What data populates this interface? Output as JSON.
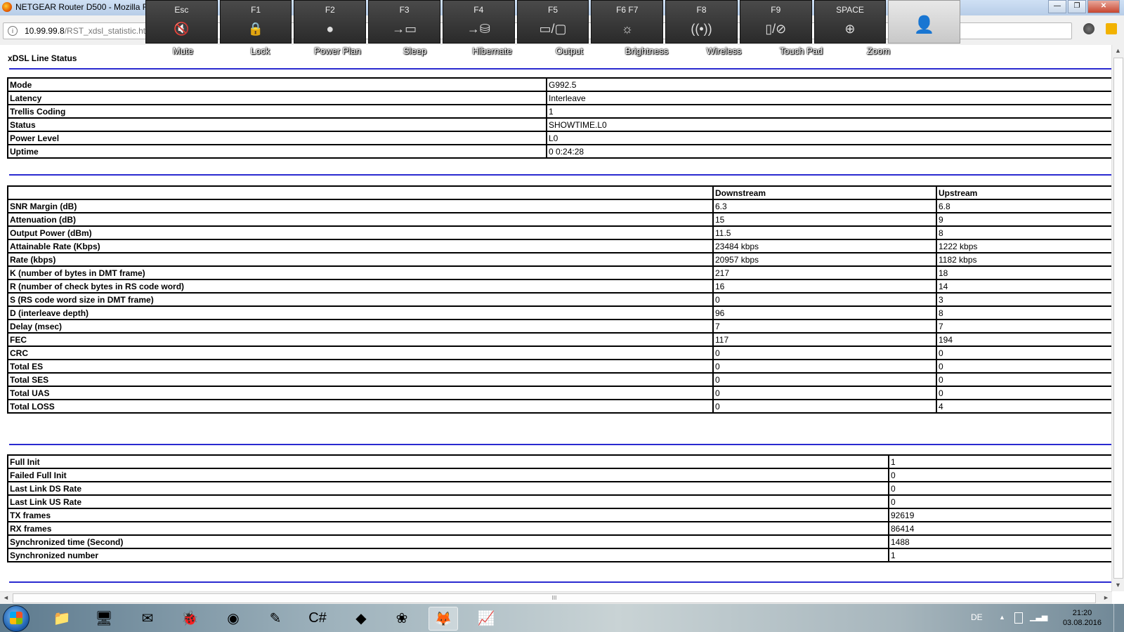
{
  "window": {
    "title": "NETGEAR Router D500 - Mozilla Firefox",
    "minimize": "—",
    "maximize": "❐",
    "close": "✕"
  },
  "browser": {
    "url_host": "10.99.99.8",
    "url_path": "/RST_xdsl_statistic.htm",
    "info_icon": "i"
  },
  "hotkeys": [
    {
      "key": "Esc",
      "label": "Mute",
      "icon": "mute-icon",
      "glyph": "🔇"
    },
    {
      "key": "F1",
      "label": "Lock",
      "icon": "lock-icon",
      "glyph": "🔒"
    },
    {
      "key": "F2",
      "label": "Power Plan",
      "icon": "power-plan-icon",
      "glyph": "●"
    },
    {
      "key": "F3",
      "label": "Sleep",
      "icon": "sleep-icon",
      "glyph": "→▭"
    },
    {
      "key": "F4",
      "label": "Hibernate",
      "icon": "hibernate-icon",
      "glyph": "→⛁"
    },
    {
      "key": "F5",
      "label": "Output",
      "icon": "output-icon",
      "glyph": "▭/▢"
    },
    {
      "key": "F6      F7",
      "label": "Brightness",
      "icon": "brightness-icon",
      "glyph": "☼"
    },
    {
      "key": "F8",
      "label": "Wireless",
      "icon": "wireless-icon",
      "glyph": "((•))"
    },
    {
      "key": "F9",
      "label": "Touch Pad",
      "icon": "touchpad-icon",
      "glyph": "▯/⊘"
    },
    {
      "key": "SPACE",
      "label": "Zoom",
      "icon": "zoom-icon",
      "glyph": "⊕"
    }
  ],
  "page": {
    "title": "xDSL Line Status"
  },
  "line_status": [
    {
      "label": "Mode",
      "value": "G992.5"
    },
    {
      "label": "Latency",
      "value": "Interleave"
    },
    {
      "label": "Trellis Coding",
      "value": "1"
    },
    {
      "label": "Status",
      "value": "SHOWTIME.L0"
    },
    {
      "label": "Power Level",
      "value": "L0"
    },
    {
      "label": "Uptime",
      "value": "0 0:24:28"
    }
  ],
  "stats": {
    "headers": [
      "",
      "Downstream",
      "Upstream"
    ],
    "rows": [
      {
        "label": "SNR Margin (dB)",
        "down": "6.3",
        "up": "6.8"
      },
      {
        "label": "Attenuation (dB)",
        "down": "15",
        "up": "9"
      },
      {
        "label": "Output Power (dBm)",
        "down": "11.5",
        "up": "8"
      },
      {
        "label": "Attainable Rate (Kbps)",
        "down": "23484 kbps",
        "up": "1222 kbps"
      },
      {
        "label": "Rate (kbps)",
        "down": "20957 kbps",
        "up": "1182 kbps"
      },
      {
        "label": "K (number of bytes in DMT frame)",
        "down": "217",
        "up": "18"
      },
      {
        "label": "R (number of check bytes in RS code word)",
        "down": "16",
        "up": "14"
      },
      {
        "label": "S (RS code word size in DMT frame)",
        "down": "0",
        "up": "3"
      },
      {
        "label": "D (interleave depth)",
        "down": "96",
        "up": "8"
      },
      {
        "label": "Delay (msec)",
        "down": "7",
        "up": "7"
      },
      {
        "label": "FEC",
        "down": "117",
        "up": "194"
      },
      {
        "label": "CRC",
        "down": "0",
        "up": "0"
      },
      {
        "label": "Total ES",
        "down": "0",
        "up": "0"
      },
      {
        "label": "Total SES",
        "down": "0",
        "up": "0"
      },
      {
        "label": "Total UAS",
        "down": "0",
        "up": "0"
      },
      {
        "label": "Total LOSS",
        "down": "0",
        "up": "4"
      }
    ]
  },
  "counters": [
    {
      "label": "Full Init",
      "value": "1"
    },
    {
      "label": "Failed Full Init",
      "value": "0"
    },
    {
      "label": "Last Link DS Rate",
      "value": "0"
    },
    {
      "label": "Last Link US Rate",
      "value": "0"
    },
    {
      "label": "TX frames",
      "value": "92619"
    },
    {
      "label": "RX frames",
      "value": "86414"
    },
    {
      "label": "Synchronized time (Second)",
      "value": "1488"
    },
    {
      "label": "Synchronized number",
      "value": "1"
    }
  ],
  "scroll": {
    "grip": "III",
    "up": "▲",
    "down": "▼",
    "left": "◄",
    "right": "►"
  },
  "taskbar": {
    "apps": [
      {
        "name": "explorer-icon",
        "glyph": "📁"
      },
      {
        "name": "device-manager-icon",
        "glyph": "🖥"
      },
      {
        "name": "thunderbird-icon",
        "glyph": "✉"
      },
      {
        "name": "bug-app-icon",
        "glyph": "🐞"
      },
      {
        "name": "chrome-icon",
        "glyph": "◉"
      },
      {
        "name": "notepad-pen-icon",
        "glyph": "✎"
      },
      {
        "name": "csharp-icon",
        "glyph": "C#"
      },
      {
        "name": "cube-app-icon",
        "glyph": "◆"
      },
      {
        "name": "raspberry-icon",
        "glyph": "❀"
      },
      {
        "name": "firefox-icon",
        "glyph": "🦊"
      },
      {
        "name": "chart-app-icon",
        "glyph": "📈"
      }
    ],
    "active_app": 9,
    "language": "DE",
    "time": "21:20",
    "date": "03.08.2016"
  },
  "colors": {
    "separator": "#2a2ad0",
    "osd_key": "#333333"
  }
}
